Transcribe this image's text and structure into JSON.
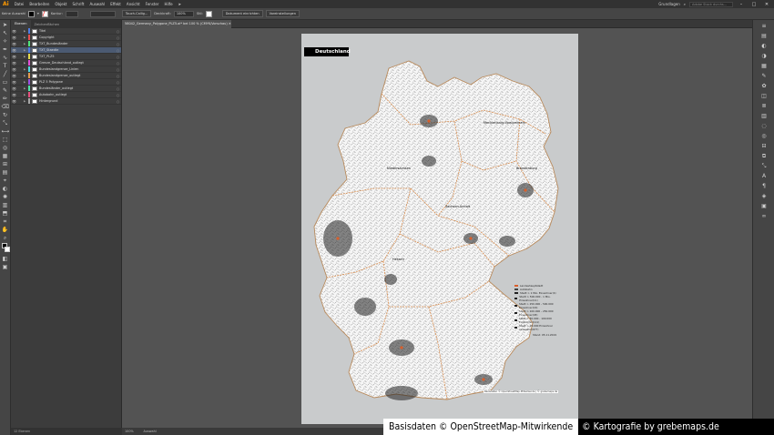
{
  "app": {
    "logo": "Ai",
    "menu": [
      "Datei",
      "Bearbeiten",
      "Objekt",
      "Schrift",
      "Auswahl",
      "Effekt",
      "Ansicht",
      "Fenster",
      "Hilfe"
    ],
    "workspace": "Grundlagen",
    "search_placeholder": "Adobe Stock durchs..."
  },
  "control_bar": {
    "selection_label": "Keine Auswahl",
    "stroke_label": "Kontur:",
    "brush_label": "Touch-Callig...",
    "opacity_label": "Deckkraft:",
    "opacity_value": "100%",
    "style_label": "Stil:",
    "doc_setup_button": "Dokument einrichten",
    "preferences_button": "Voreinstellungen"
  },
  "layers_panel": {
    "tabs": [
      "Ebenen",
      "Zeichenflächen"
    ],
    "layers": [
      {
        "name": "Titel",
        "color": "#4f7de3",
        "selected": false
      },
      {
        "name": "Copyright",
        "color": "#e34f4f",
        "selected": false
      },
      {
        "name": "TXT_Bundesländer",
        "color": "#4fe37a",
        "selected": false
      },
      {
        "name": "TXT_Staedte",
        "color": "#4f7de3",
        "selected": true
      },
      {
        "name": "TXT_PLZ5",
        "color": "#e3d84f",
        "selected": false
      },
      {
        "name": "Grenze_Deutschland_outlegt",
        "color": "#e34fd8",
        "selected": false
      },
      {
        "name": "Bundeslandgrenze_Linien",
        "color": "#4fd8e3",
        "selected": false
      },
      {
        "name": "Bundeslandgrenze_outlegt",
        "color": "#e39a4f",
        "selected": false
      },
      {
        "name": "PLZ 5 Polygone",
        "color": "#9a4fe3",
        "selected": false
      },
      {
        "name": "Bundesländer_outlegt",
        "color": "#4fe3a8",
        "selected": false
      },
      {
        "name": "Autobahn_outlegt",
        "color": "#e34f7d",
        "selected": false
      },
      {
        "name": "Hintergrund",
        "color": "#a8a8a8",
        "selected": false
      }
    ],
    "footer": "12 Ebenen"
  },
  "document": {
    "tab_title": "58042_Germany_Polygone_PLZ5.ai* bei 100 % (CMYK/Vorschau)",
    "status_zoom": "100%",
    "status_tool": "Auswahl"
  },
  "map": {
    "title": "Deutschland",
    "state_labels": [
      "Mecklenburg-Vorpommern",
      "Brandenburg",
      "Niedersachsen",
      "Sachsen-Anhalt",
      "Hessen"
    ],
    "legend": [
      {
        "label": "Landeshauptstadt",
        "color": "#d95f2b"
      },
      {
        "label": "Autobahn",
        "color": "#444444"
      },
      {
        "label": "Stadt > 1 Mio. Einwohner(4)",
        "color": "#222222"
      },
      {
        "label": "Stadt > 500.000 - 1 Mio. Einwohner(11)",
        "color": "#222222"
      },
      {
        "label": "Stadt > 250.000 - 500.000 Einwohner(16)",
        "color": "#222222"
      },
      {
        "label": "Stadt > 100.000 - 250.000 Einwohner(45)",
        "color": "#222222"
      },
      {
        "label": "Stadt > 50.000 - 100.000 Einwohner(111)",
        "color": "#222222"
      },
      {
        "label": "Stadt > 20.000 Einwohner (Auswahl)(677)",
        "color": "#222222"
      }
    ],
    "legend_note": "Stand: 05.11.2019",
    "small_credit": "Basisdaten © OpenStreetMap-Mitwirkende | © grebemaps.de"
  },
  "watermark": {
    "left": "Basisdaten © OpenStreetMap-Mitwirkende",
    "right": "© Kartografie by grebemaps.de"
  }
}
